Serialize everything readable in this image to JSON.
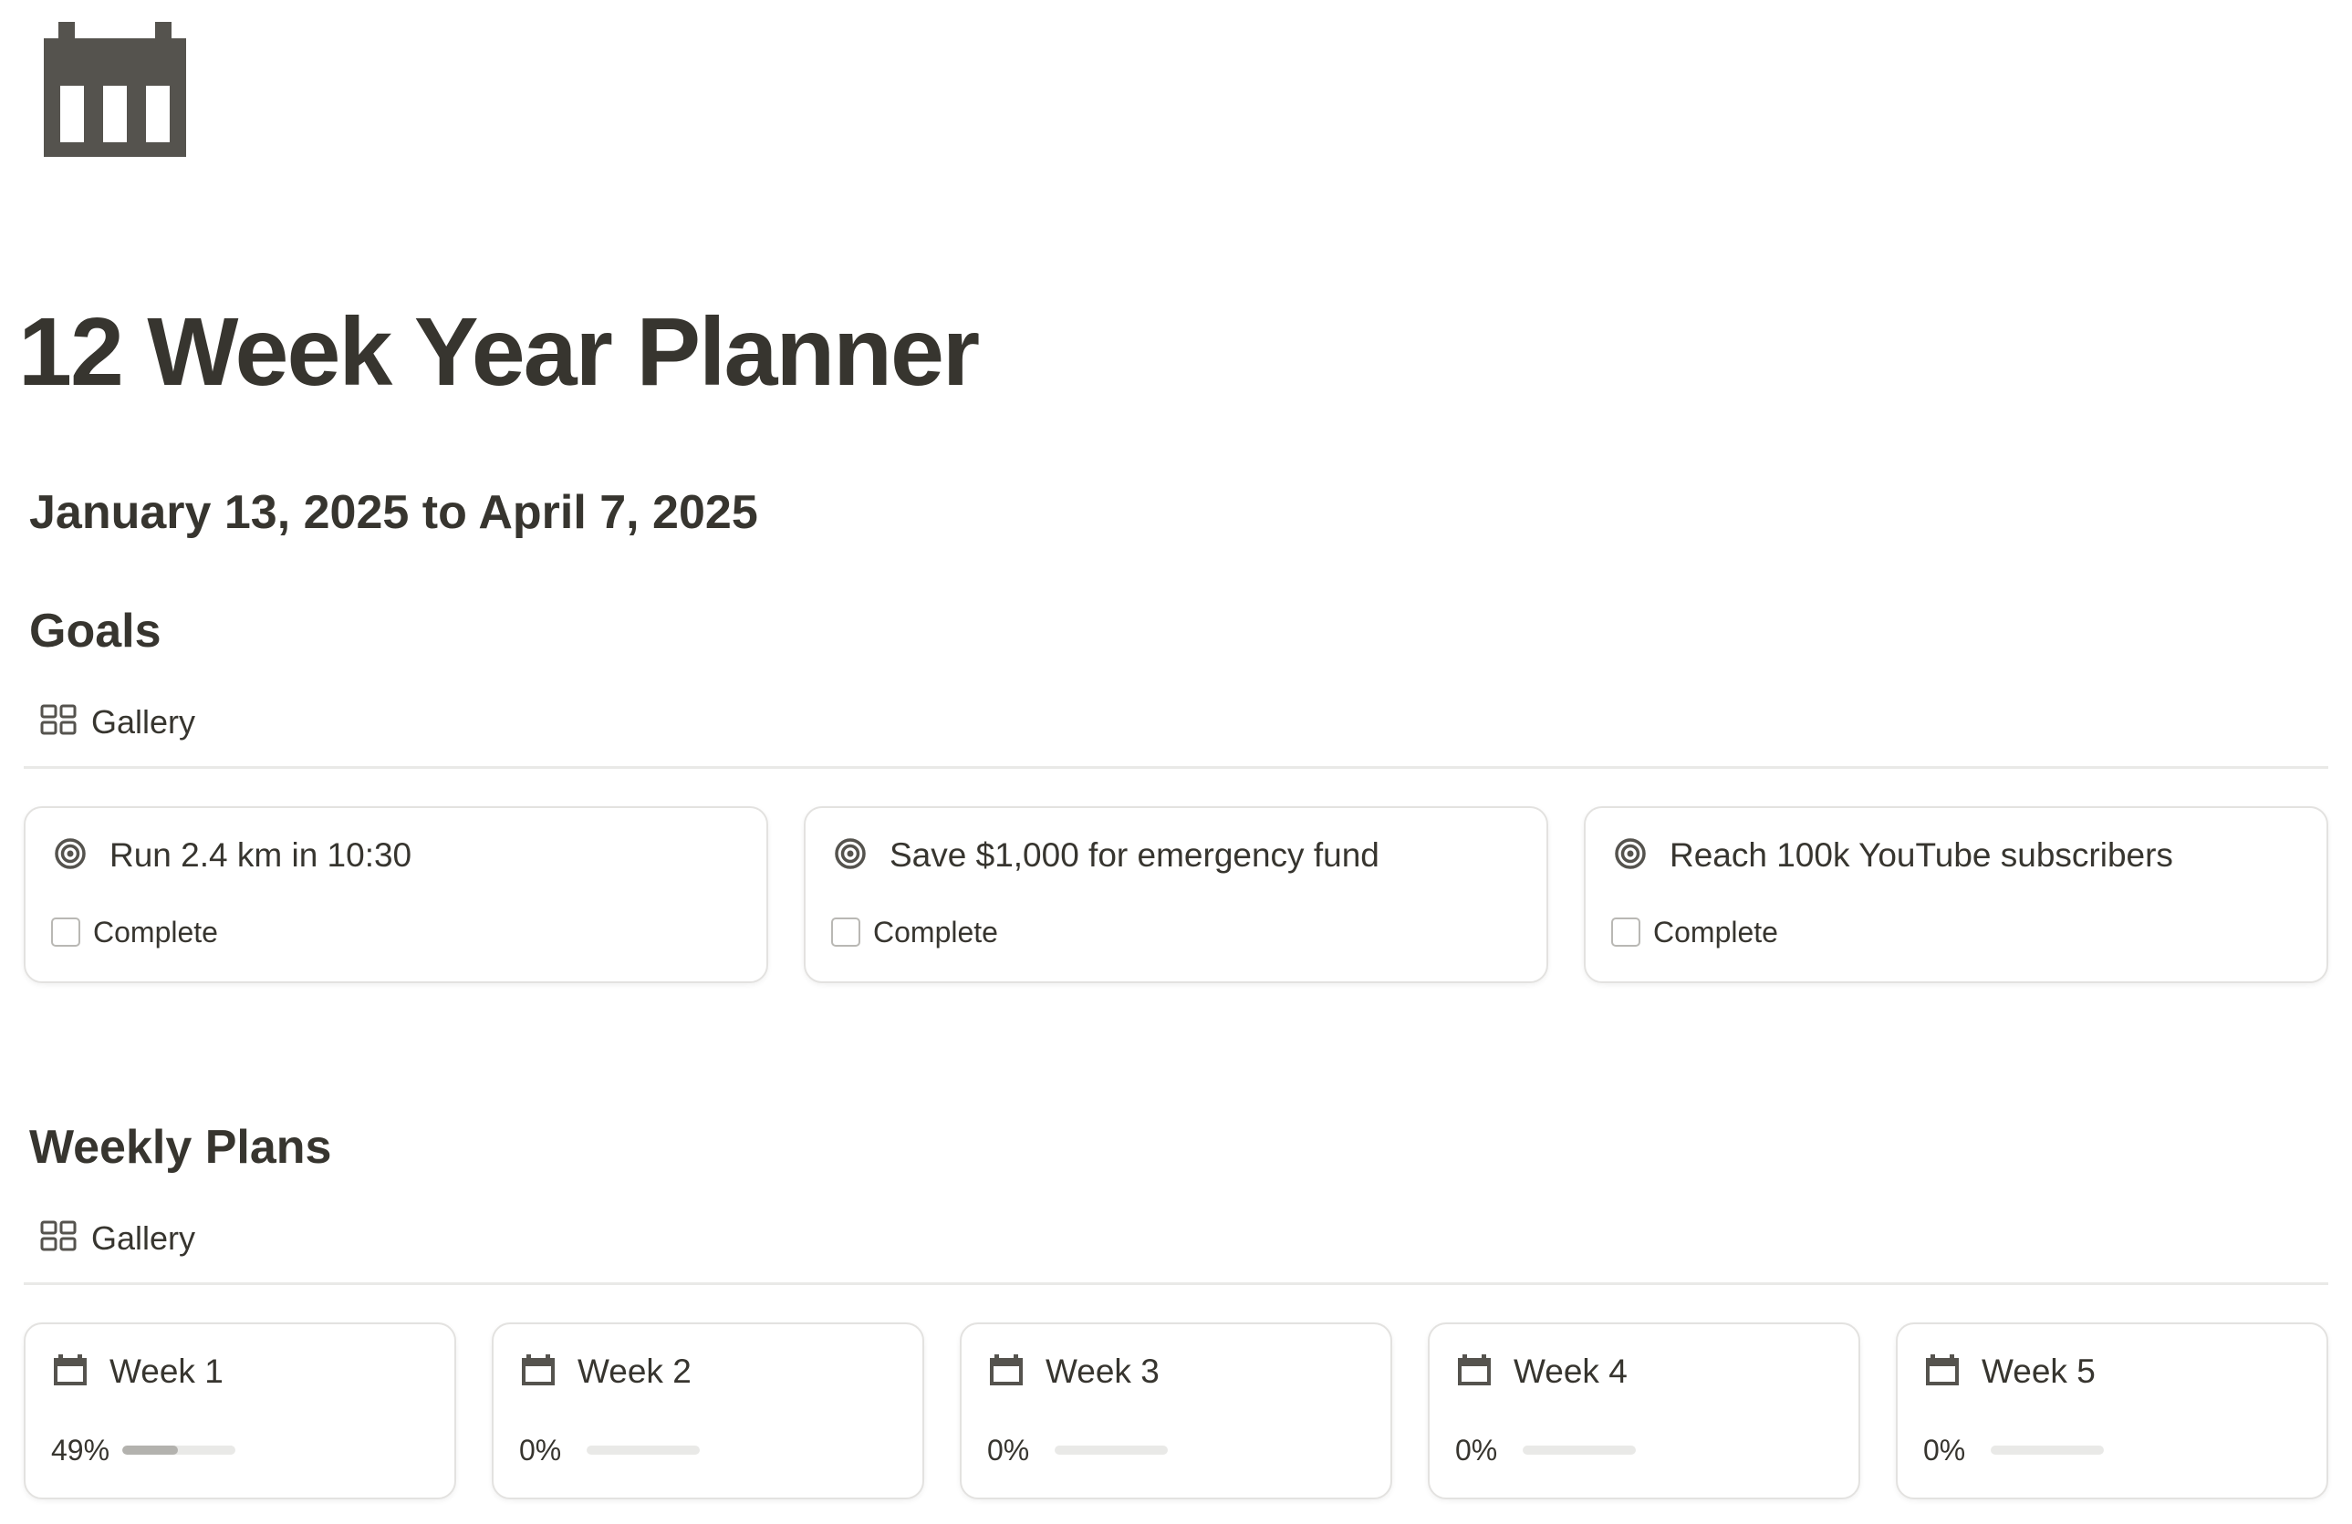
{
  "page": {
    "icon": "calendar-icon",
    "title": "12 Week Year Planner",
    "date_range": "January 13, 2025 to April 7, 2025"
  },
  "goals": {
    "heading": "Goals",
    "view": {
      "label": "Gallery",
      "icon": "gallery-icon"
    },
    "cards": [
      {
        "title": "Run 2.4 km in 10:30",
        "icon": "target-icon",
        "property_label": "Complete",
        "checked": false
      },
      {
        "title": "Save $1,000 for emergency fund",
        "icon": "target-icon",
        "property_label": "Complete",
        "checked": false
      },
      {
        "title": "Reach 100k YouTube subscribers",
        "icon": "target-icon",
        "property_label": "Complete",
        "checked": false
      }
    ]
  },
  "weekly_plans": {
    "heading": "Weekly Plans",
    "view": {
      "label": "Gallery",
      "icon": "gallery-icon"
    },
    "cards": [
      {
        "title": "Week 1",
        "icon": "calendar-icon",
        "progress_text": "49%",
        "progress": 0.49
      },
      {
        "title": "Week 2",
        "icon": "calendar-icon",
        "progress_text": "0%",
        "progress": 0
      },
      {
        "title": "Week 3",
        "icon": "calendar-icon",
        "progress_text": "0%",
        "progress": 0
      },
      {
        "title": "Week 4",
        "icon": "calendar-icon",
        "progress_text": "0%",
        "progress": 0
      },
      {
        "title": "Week 5",
        "icon": "calendar-icon",
        "progress_text": "0%",
        "progress": 0
      }
    ]
  },
  "colors": {
    "text": "#37352f",
    "icon": "#55534e",
    "border": "#e3e2e0",
    "divider": "#e9e9e7",
    "progress_fill": "#b3b2ae",
    "progress_track": "#e9e9e7"
  }
}
